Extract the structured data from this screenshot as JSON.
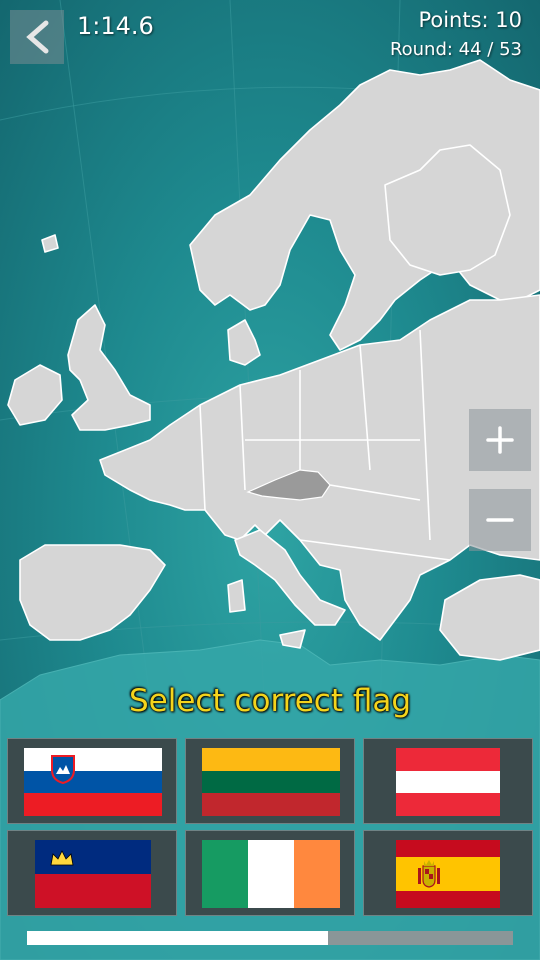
{
  "header": {
    "timer": "1:14.6",
    "points_label": "Points: 10",
    "round_label": "Round: 44 / 53",
    "back_icon": "back-arrow-icon"
  },
  "map": {
    "highlighted_country": "Austria",
    "zoom_in_icon": "plus-icon",
    "zoom_out_icon": "minus-icon"
  },
  "prompt": "Select correct flag",
  "flags": [
    {
      "name": "Slovenia"
    },
    {
      "name": "Lithuania"
    },
    {
      "name": "Austria"
    },
    {
      "name": "Liechtenstein"
    },
    {
      "name": "Ireland"
    },
    {
      "name": "Spain"
    }
  ],
  "progress": {
    "fraction": 0.62
  },
  "colors": {
    "sea": "#1e8a8f",
    "land": "#d6d6d6",
    "highlight": "#9a9a9a",
    "prompt": "#f4d41c"
  }
}
